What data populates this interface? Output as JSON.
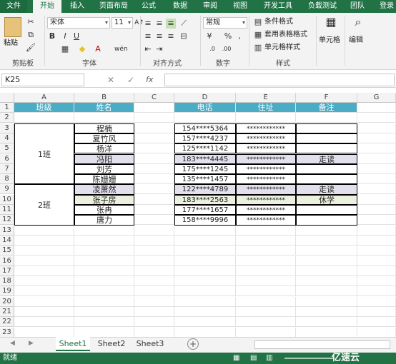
{
  "tabs": [
    "文件",
    "开始",
    "插入",
    "页面布局",
    "公式",
    "数据",
    "审阅",
    "视图",
    "开发工具",
    "负载测试",
    "团队",
    "登录"
  ],
  "ribbon": {
    "clipboard": {
      "paste": "粘贴",
      "label": "剪贴板"
    },
    "font": {
      "name": "宋体",
      "size": "11",
      "label": "字体"
    },
    "align": {
      "label": "对齐方式"
    },
    "number": {
      "format": "常规",
      "label": "数字"
    },
    "styles": {
      "cond": "条件格式",
      "table": "套用表格格式",
      "cell": "单元格样式",
      "label": "样式"
    },
    "cells": {
      "label": "单元格"
    },
    "edit": {
      "label": "编辑"
    }
  },
  "formula": {
    "namebox": "K25",
    "fx": "fx"
  },
  "columns": [
    "A",
    "B",
    "C",
    "D",
    "E",
    "F",
    "G"
  ],
  "rows": [
    "1",
    "2",
    "3",
    "4",
    "5",
    "6",
    "7",
    "8",
    "9",
    "10",
    "11",
    "12",
    "13",
    "14",
    "15",
    "16",
    "17",
    "18",
    "19",
    "20",
    "21",
    "22",
    "23"
  ],
  "headers": {
    "a": "班级",
    "b": "姓名",
    "d": "电话",
    "e": "住址",
    "f": "备注"
  },
  "classes": [
    "1班",
    "2班"
  ],
  "names": [
    "程楠",
    "夏竹风",
    "杨洋",
    "冯阳",
    "刘芳",
    "陈姗姗",
    "凌萧然",
    "张子房",
    "张冉",
    "唐力"
  ],
  "phones": [
    "154****5364",
    "157****4237",
    "125****1142",
    "183****4445",
    "175****1245",
    "135****1457",
    "122****4789",
    "183****2563",
    "177****1657",
    "158****9996"
  ],
  "addresses": [
    "************",
    "************",
    "************",
    "************",
    "************",
    "************",
    "************",
    "************",
    "************",
    "************"
  ],
  "notes": [
    "",
    "",
    "",
    "走读",
    "",
    "",
    "走读",
    "休学",
    "",
    ""
  ],
  "sheets": [
    "Sheet1",
    "Sheet2",
    "Sheet3"
  ],
  "status": "就绪",
  "watermark": "亿速云",
  "colors": {
    "accent": "#217346",
    "header": "#4bacc6",
    "highlight": "#e4dfec",
    "highlight2": "#ebf1de"
  }
}
